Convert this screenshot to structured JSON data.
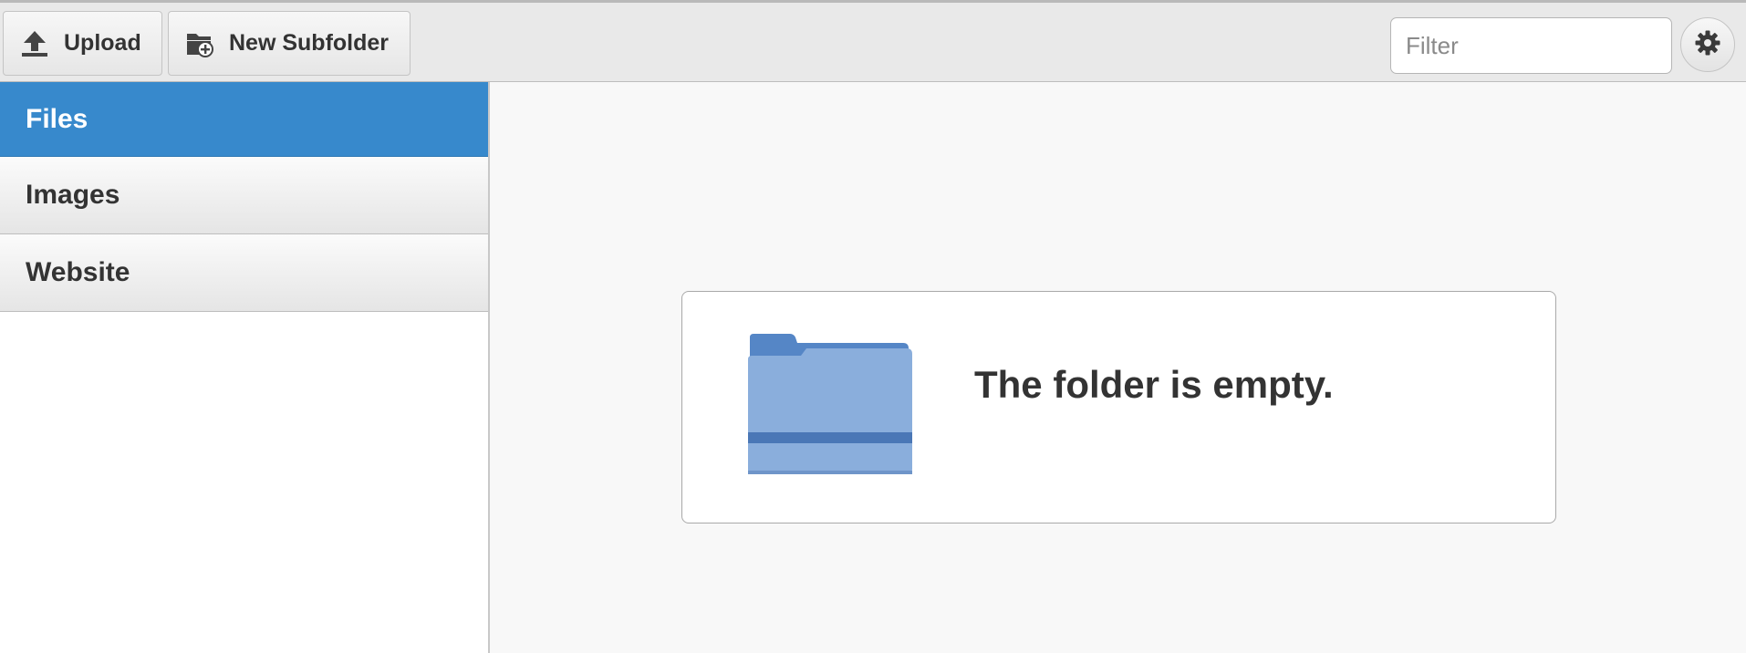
{
  "toolbar": {
    "upload_label": "Upload",
    "new_subfolder_label": "New Subfolder",
    "filter_placeholder": "Filter",
    "filter_value": "",
    "upload_icon": "upload-arrow-icon",
    "new_subfolder_icon": "folder-add-icon",
    "settings_icon": "gear-icon"
  },
  "sidebar": {
    "items": [
      {
        "label": "Files",
        "active": true
      },
      {
        "label": "Images",
        "active": false
      },
      {
        "label": "Website",
        "active": false
      }
    ],
    "active_color": "#3789cc"
  },
  "main": {
    "empty_message": "The folder is empty.",
    "empty_icon": "folder-icon",
    "folder_color": "#8aaedc"
  }
}
